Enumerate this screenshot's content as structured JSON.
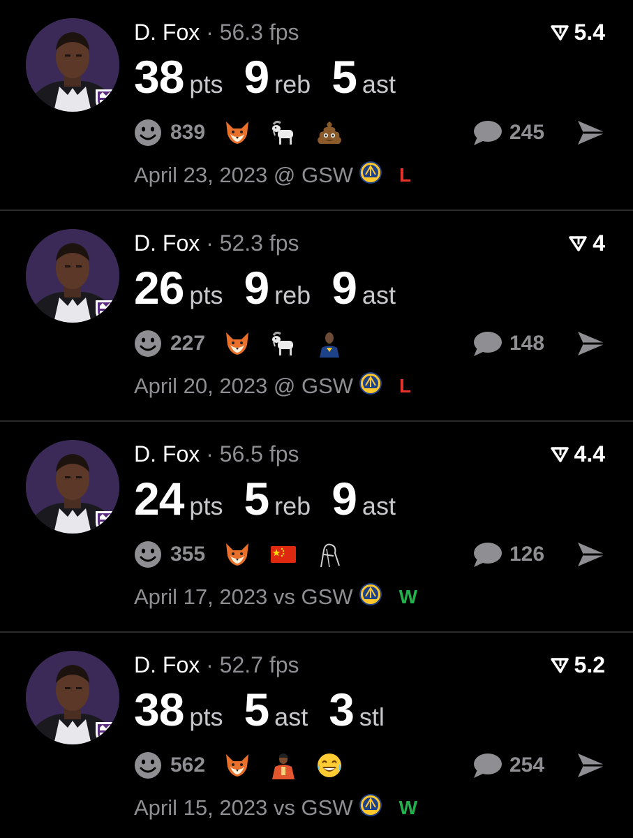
{
  "colors": {
    "loss": "#e5342b",
    "win": "#22b14c",
    "muted": "#8e8e93"
  },
  "icons": {
    "rating": "downvote-arrow-icon",
    "react": "smiley-face-icon",
    "comment": "speech-bubble-icon",
    "share": "send-arrow-icon",
    "team": "gsw-logo-icon"
  },
  "posts": [
    {
      "player": "D. Fox",
      "separator": "·",
      "fps": "56.3 fps",
      "rating": "5.4",
      "stats": [
        {
          "value": "38",
          "label": "pts"
        },
        {
          "value": "9",
          "label": "reb"
        },
        {
          "value": "5",
          "label": "ast"
        }
      ],
      "reaction_count": "839",
      "reaction_emojis": [
        "fox",
        "goat",
        "poop"
      ],
      "comment_count": "245",
      "date_line": "April 23, 2023 @ GSW",
      "result": "L"
    },
    {
      "player": "D. Fox",
      "separator": "·",
      "fps": "52.3 fps",
      "rating": "4",
      "stats": [
        {
          "value": "26",
          "label": "pts"
        },
        {
          "value": "9",
          "label": "reb"
        },
        {
          "value": "9",
          "label": "ast"
        }
      ],
      "reaction_count": "227",
      "reaction_emojis": [
        "fox",
        "goat",
        "player"
      ],
      "comment_count": "148",
      "date_line": "April 20, 2023 @ GSW",
      "result": "L"
    },
    {
      "player": "D. Fox",
      "separator": "·",
      "fps": "56.5 fps",
      "rating": "4.4",
      "stats": [
        {
          "value": "24",
          "label": "pts"
        },
        {
          "value": "5",
          "label": "reb"
        },
        {
          "value": "9",
          "label": "ast"
        }
      ],
      "reaction_count": "355",
      "reaction_emojis": [
        "fox",
        "china-flag",
        "sketch"
      ],
      "comment_count": "126",
      "date_line": "April 17, 2023 vs GSW",
      "result": "W"
    },
    {
      "player": "D. Fox",
      "separator": "·",
      "fps": "52.7 fps",
      "rating": "5.2",
      "stats": [
        {
          "value": "38",
          "label": "pts"
        },
        {
          "value": "5",
          "label": "ast"
        },
        {
          "value": "3",
          "label": "stl"
        }
      ],
      "reaction_count": "562",
      "reaction_emojis": [
        "fox",
        "person",
        "laughing"
      ],
      "comment_count": "254",
      "date_line": "April 15, 2023 vs GSW",
      "result": "W"
    }
  ]
}
